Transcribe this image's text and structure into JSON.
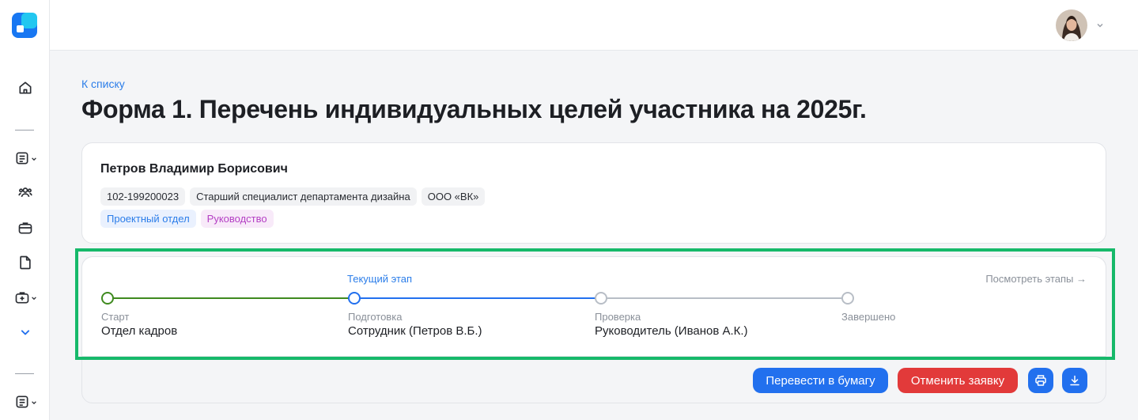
{
  "colors": {
    "accent": "#2270ee",
    "link": "#2b7de9",
    "danger": "#e23a3a",
    "stage_done": "#3f8a1f",
    "stage_pending": "#b8bec6",
    "highlight": "#16b96a"
  },
  "sidebar": {
    "items": [
      {
        "icon": "home-icon"
      },
      {
        "icon": "document-list-icon"
      },
      {
        "icon": "users-icon"
      },
      {
        "icon": "briefcase-icon"
      },
      {
        "icon": "file-icon"
      },
      {
        "icon": "medkit-icon"
      },
      {
        "icon": "chevron-down-icon"
      },
      {
        "icon": "document-list-icon"
      }
    ]
  },
  "header": {
    "avatar_icon": "user-avatar",
    "menu_icon": "chevron-down-icon"
  },
  "page": {
    "back_link": "К списку",
    "title": "Форма 1. Перечень индивидуальных целей участника на 2025г."
  },
  "person": {
    "name": "Петров Владимир Борисович",
    "tags": [
      "102-199200023",
      "Старший специалист департамента дизайна",
      "ООО «ВК»"
    ],
    "tags2": [
      "Проектный отдел",
      "Руководство"
    ]
  },
  "stages": {
    "current_label": "Текущий этап",
    "view_all": "Посмотреть этапы →",
    "items": [
      {
        "label": "Старт",
        "value": "Отдел кадров",
        "status": "done"
      },
      {
        "label": "Подготовка",
        "value": "Сотрудник (Петров В.Б.)",
        "status": "current"
      },
      {
        "label": "Проверка",
        "value": "Руководитель (Иванов А.К.)",
        "status": "pending"
      },
      {
        "label": "Завершено",
        "value": "",
        "status": "pending"
      }
    ]
  },
  "actions": {
    "to_paper": "Перевести в бумагу",
    "cancel": "Отменить заявку",
    "print_icon": "print-icon",
    "download_icon": "download-icon"
  }
}
